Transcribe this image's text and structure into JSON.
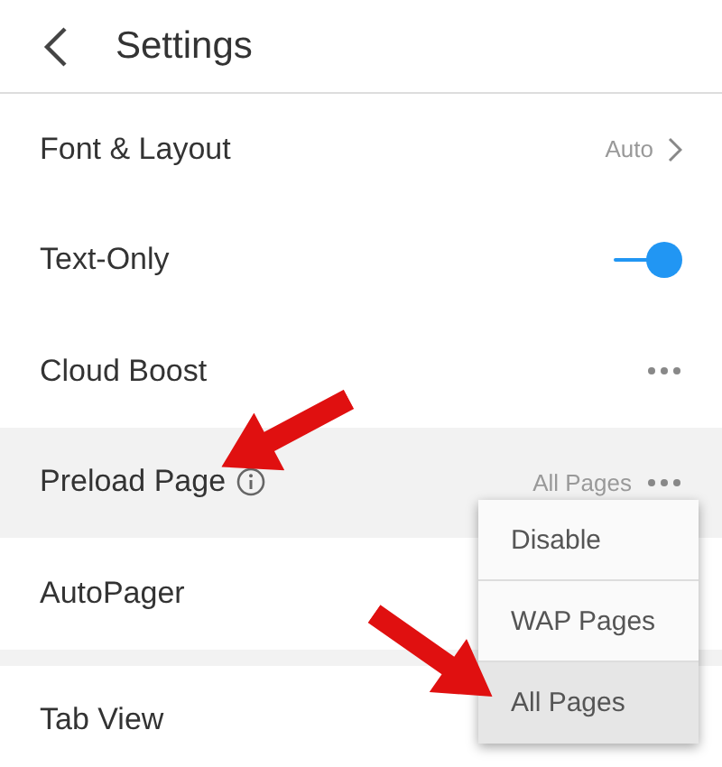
{
  "header": {
    "title": "Settings"
  },
  "rows": [
    {
      "label": "Font & Layout",
      "kind": "chevron",
      "value": "Auto",
      "highlighted": false,
      "info": false
    },
    {
      "label": "Text-Only",
      "kind": "toggle",
      "on": true,
      "highlighted": false,
      "info": false
    },
    {
      "label": "Cloud Boost",
      "kind": "more",
      "highlighted": false,
      "info": false
    },
    {
      "label": "Preload Page",
      "kind": "more",
      "value": "All Pages",
      "highlighted": true,
      "info": true
    },
    {
      "label": "AutoPager",
      "kind": "plain",
      "highlighted": false,
      "info": false
    },
    {
      "label": "Tab View",
      "kind": "plain",
      "highlighted": false,
      "info": false,
      "section_gap": true
    }
  ],
  "menu": {
    "items": [
      {
        "label": "Disable",
        "selected": false
      },
      {
        "label": "WAP Pages",
        "selected": false
      },
      {
        "label": "All Pages",
        "selected": true
      }
    ]
  }
}
